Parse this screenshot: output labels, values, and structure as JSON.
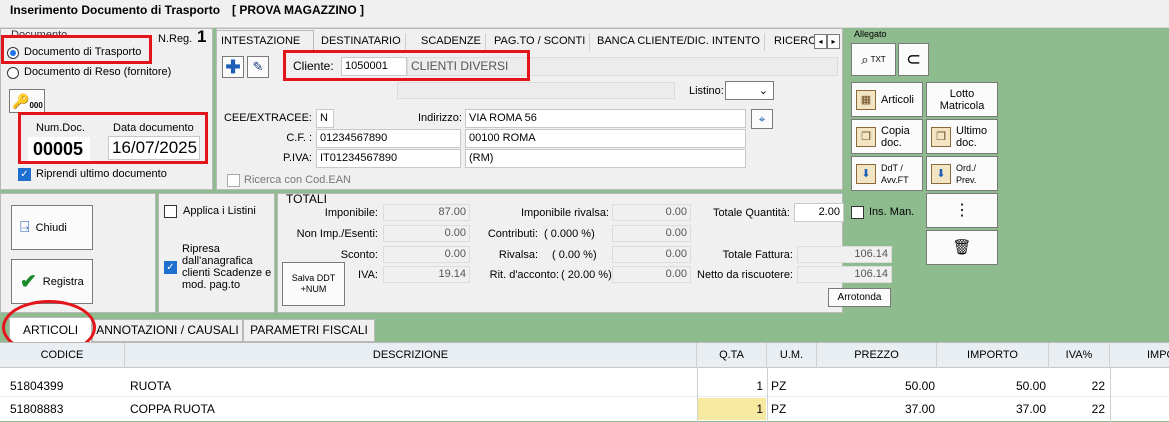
{
  "window": {
    "title": "Inserimento Documento di Trasporto",
    "subtitle": "[ PROVA MAGAZZINO ]"
  },
  "document": {
    "group_label": "Documento",
    "nreg_label": "N.Reg.",
    "nreg_value": "1",
    "option_trasporto": "Documento di Trasporto",
    "option_reso": "Documento di Reso (fornitore)",
    "badge": "000",
    "num_doc_label": "Num.Doc.",
    "num_doc_value": "00005",
    "data_label": "Data documento",
    "data_value": "16/07/2025",
    "riprendi_label": "Riprendi ultimo documento"
  },
  "tabs": [
    "INTESTAZIONE",
    "DESTINATARIO",
    "SCADENZE",
    "PAG.TO / SCONTI",
    "BANCA CLIENTE/DIC. INTENTO",
    "RICERC"
  ],
  "intestazione": {
    "cliente_label": "Cliente:",
    "cliente_code": "1050001",
    "cliente_name": "CLIENTI DIVERSI",
    "listino_label": "Listino:",
    "cee_label": "CEE/EXTRACEE:",
    "cee_value": "N",
    "indirizzo_label": "Indirizzo:",
    "indirizzo_value": "VIA ROMA 56",
    "cf_label": "C.F. :",
    "cf_value": "01234567890",
    "cap_value": "00100 ROMA",
    "piva_label": "P.IVA:",
    "piva_value": "IT01234567890",
    "prov_value": "(RM)",
    "ean_label": "Ricerca con Cod.EAN"
  },
  "allegato": {
    "label": "Allegato",
    "txt_label": "TXT"
  },
  "right_buttons": {
    "articoli": "Articoli",
    "lotto": "Lotto Matricola",
    "copia": "Copia doc.",
    "ultimo": "Ultimo doc.",
    "ddt": "DdT / Avv.FT",
    "ord": "Ord./ Prev."
  },
  "actions": {
    "chiudi": "Chiudi",
    "registra": "Registra",
    "applica_listini": "Applica i Listini",
    "ripresa": "Ripresa dall'anagrafica clienti Scadenze e mod. pag.to",
    "salva_ddt": "Salva DDT +NUM"
  },
  "totali": {
    "title": "TOTALI",
    "imponibile_label": "Imponibile:",
    "imponibile": "87.00",
    "nonimp_label": "Non Imp./Esenti:",
    "nonimp": "0.00",
    "sconto_label": "Sconto:",
    "sconto": "0.00",
    "iva_label": "IVA:",
    "iva": "19.14",
    "imp_rivalsa_label": "Imponibile rivalsa:",
    "imp_rivalsa": "0.00",
    "contributi_label": "Contributi:",
    "contributi_pct": "( 0.000 %)",
    "contributi": "0.00",
    "rivalsa_label": "Rivalsa:",
    "rivalsa_pct": "( 0.00 %)",
    "rivalsa": "0.00",
    "rit_label": "Rit. d'acconto:",
    "rit_pct": "( 20.00 %)",
    "rit": "0.00",
    "tot_qta_label": "Totale Quantità:",
    "tot_qta": "2.00",
    "ins_man_label": "Ins. Man.",
    "tot_fattura_label": "Totale Fattura:",
    "tot_fattura": "106.14",
    "netto_label": "Netto da riscuotere:",
    "netto": "106.14",
    "arrotonda": "Arrotonda"
  },
  "bottom_tabs": [
    "ARTICOLI",
    "ANNOTAZIONI / CAUSALI",
    "PARAMETRI FISCALI"
  ],
  "table": {
    "headers": [
      "CODICE",
      "DESCRIZIONE",
      "Q.TA",
      "U.M.",
      "PREZZO",
      "IMPORTO",
      "IVA%",
      "IMPO"
    ],
    "rows": [
      [
        "51804399",
        "RUOTA",
        "1",
        "PZ",
        "50.00",
        "50.00",
        "22"
      ],
      [
        "51808883",
        "COPPA RUOTA",
        "1",
        "PZ",
        "37.00",
        "37.00",
        "22"
      ]
    ]
  },
  "colors": {
    "accent_red": "#e4141b",
    "background_green": "#8fbc8f",
    "qty_highlight": "#f8e9a1"
  }
}
